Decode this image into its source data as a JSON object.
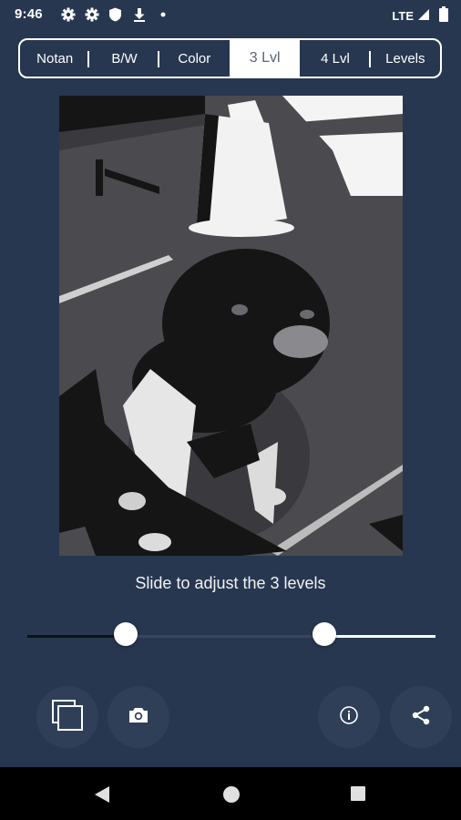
{
  "status": {
    "time": "9:46",
    "network": "LTE",
    "icons": [
      "gear-icon",
      "gear-icon",
      "shield-icon",
      "download-icon",
      "dot-icon"
    ]
  },
  "tabs": [
    {
      "label": "Notan",
      "active": false
    },
    {
      "label": "B/W",
      "active": false
    },
    {
      "label": "Color",
      "active": false
    },
    {
      "label": "3 Lvl",
      "active": true
    },
    {
      "label": "4 Lvl",
      "active": false
    },
    {
      "label": "Levels",
      "active": false
    }
  ],
  "caption": "Slide to adjust the 3 levels",
  "slider": {
    "low_fraction": 0.24,
    "high_fraction": 0.727
  },
  "buttons": {
    "left": [
      "gallery-icon",
      "camera-icon"
    ],
    "right": [
      "info-icon",
      "share-icon"
    ]
  },
  "colors": {
    "background": "#273750",
    "button": "#2f3f58",
    "photo_dark": "#151515",
    "photo_mid": "#4a4a4f",
    "photo_light": "#ffffff",
    "slider_dark": "#111111",
    "slider_mid": "#39465a",
    "slider_light": "#ffffff"
  }
}
